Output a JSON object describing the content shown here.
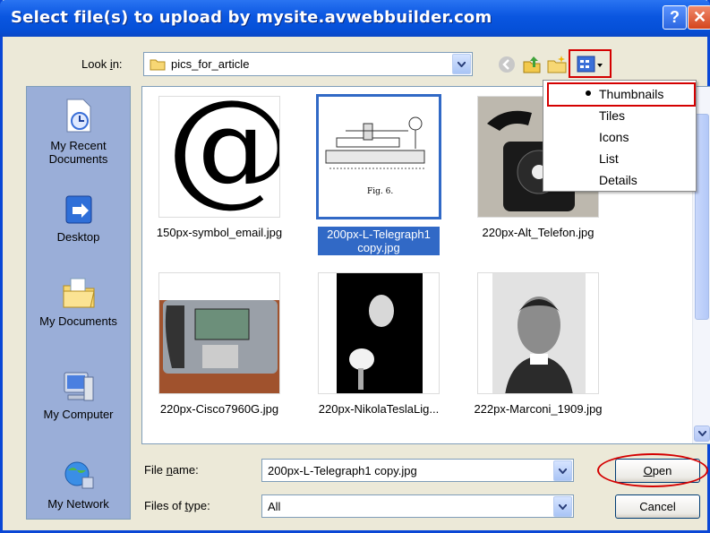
{
  "window": {
    "title": "Select file(s) to upload by mysite.avwebbuilder.com"
  },
  "lookin": {
    "label_pre": "Look ",
    "label_ul": "i",
    "label_post": "n:",
    "value": "pics_for_article"
  },
  "places": [
    {
      "label": "My Recent Documents",
      "icon": "recent-documents-icon"
    },
    {
      "label": "Desktop",
      "icon": "desktop-icon"
    },
    {
      "label": "My Documents",
      "icon": "my-documents-icon"
    },
    {
      "label": "My Computer",
      "icon": "my-computer-icon"
    },
    {
      "label": "My Network",
      "icon": "my-network-icon"
    }
  ],
  "files": [
    {
      "name": "150px-symbol_email.jpg",
      "selected": false
    },
    {
      "name": "200px-L-Telegraph1 copy.jpg",
      "selected": true
    },
    {
      "name": "220px-Alt_Telefon.jpg",
      "selected": false
    },
    {
      "name": "220px-Cisco7960G.jpg",
      "selected": false
    },
    {
      "name": "220px-NikolaTeslaLig...",
      "selected": false
    },
    {
      "name": "222px-Marconi_1909.jpg",
      "selected": false
    }
  ],
  "thumb_text": {
    "email_symbol": "@",
    "telegraph_caption": "Fig. 6."
  },
  "views_menu": {
    "items": [
      "Thumbnails",
      "Tiles",
      "Icons",
      "List",
      "Details"
    ],
    "selected": "Thumbnails"
  },
  "filename": {
    "label_pre": "File ",
    "label_ul": "n",
    "label_post": "ame:",
    "value": "200px-L-Telegraph1 copy.jpg"
  },
  "filetype": {
    "label_pre": "Files of ",
    "label_ul": "t",
    "label_post": "ype:",
    "value": "All"
  },
  "buttons": {
    "open_ul": "O",
    "open_rest": "pen",
    "cancel": "Cancel"
  },
  "colors": {
    "title_bar": "#0a56e0",
    "selection": "#3169c6",
    "highlight": "#d40000",
    "places_bg": "#9aaed8"
  }
}
